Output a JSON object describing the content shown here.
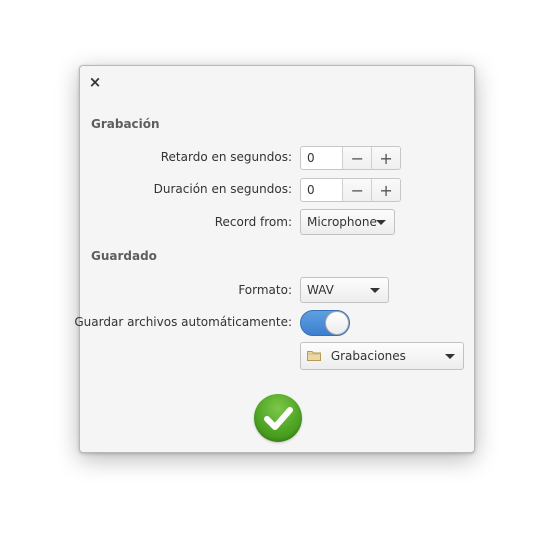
{
  "dialog": {
    "close_glyph": "×",
    "sections": {
      "recording": {
        "title": "Grabación",
        "delay": {
          "label": "Retardo en segundos:",
          "value": "0",
          "minus": "−",
          "plus": "+"
        },
        "duration": {
          "label": "Duración en segundos:",
          "value": "0",
          "minus": "−",
          "plus": "+"
        },
        "source": {
          "label": "Record from:",
          "selected": "Microphone"
        }
      },
      "saving": {
        "title": "Guardado",
        "format": {
          "label": "Formato:",
          "selected": "WAV"
        },
        "autosave": {
          "label": "Guardar archivos automáticamente:",
          "state": "on"
        },
        "folder": {
          "selected": "Grabaciones",
          "icon": "folder-icon"
        }
      }
    },
    "confirm": {
      "icon": "checkmark-icon",
      "color": "#4ea423"
    }
  },
  "colors": {
    "accent": "#3d7fd0",
    "dialog_bg": "#f5f5f5"
  }
}
